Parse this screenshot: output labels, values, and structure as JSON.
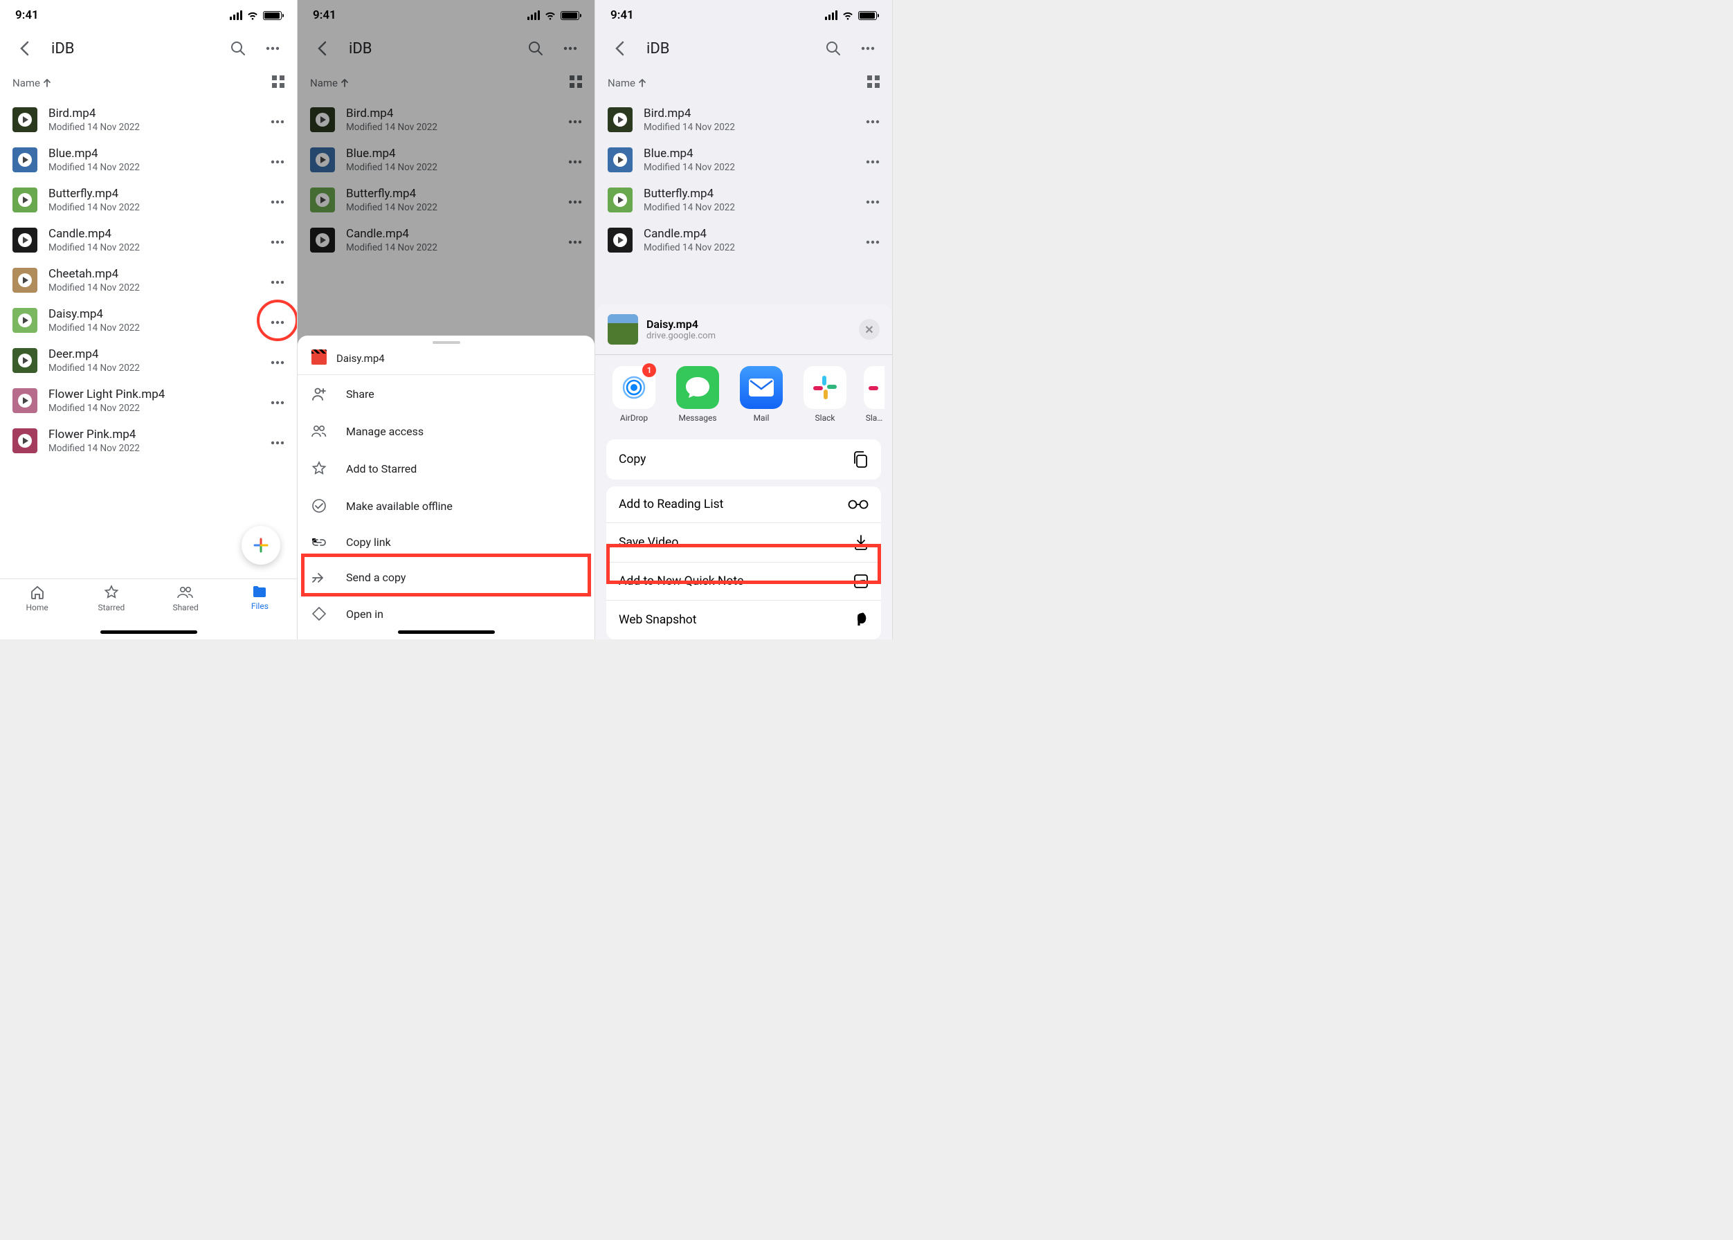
{
  "status": {
    "time": "9:41"
  },
  "header": {
    "title": "iDB"
  },
  "sort": {
    "label": "Name"
  },
  "files": [
    {
      "name": "Bird.mp4",
      "sub": "Modified 14 Nov 2022",
      "bg": "#2b3a1f"
    },
    {
      "name": "Blue.mp4",
      "sub": "Modified 14 Nov 2022",
      "bg": "#3b6ea8"
    },
    {
      "name": "Butterfly.mp4",
      "sub": "Modified 14 Nov 2022",
      "bg": "#6aa84f"
    },
    {
      "name": "Candle.mp4",
      "sub": "Modified 14 Nov 2022",
      "bg": "#1b1b1b"
    },
    {
      "name": "Cheetah.mp4",
      "sub": "Modified 14 Nov 2022",
      "bg": "#b08b5b"
    },
    {
      "name": "Daisy.mp4",
      "sub": "Modified 14 Nov 2022",
      "bg": "#7bb661"
    },
    {
      "name": "Deer.mp4",
      "sub": "Modified 14 Nov 2022",
      "bg": "#3b5d2b"
    },
    {
      "name": "Flower Light Pink.mp4",
      "sub": "Modified 14 Nov 2022",
      "bg": "#b66c8a"
    },
    {
      "name": "Flower Pink.mp4",
      "sub": "Modified 14 Nov 2022",
      "bg": "#a33c5d"
    }
  ],
  "tabs": {
    "home": "Home",
    "starred": "Starred",
    "shared": "Shared",
    "files": "Files"
  },
  "sheet": {
    "file": "Daisy.mp4",
    "share": "Share",
    "manage": "Manage access",
    "star": "Add to Starred",
    "offline": "Make available offline",
    "link": "Copy link",
    "send": "Send a copy",
    "openin": "Open in"
  },
  "p3files": [
    {
      "name": "Bird.mp4",
      "sub": "Modified 14 Nov 2022",
      "bg": "#2b3a1f"
    },
    {
      "name": "Blue.mp4",
      "sub": "Modified 14 Nov 2022",
      "bg": "#3b6ea8"
    },
    {
      "name": "Butterfly.mp4",
      "sub": "Modified 14 Nov 2022",
      "bg": "#6aa84f"
    },
    {
      "name": "Candle.mp4",
      "sub": "Modified 14 Nov 2022",
      "bg": "#1b1b1b"
    }
  ],
  "share": {
    "title": "Daisy.mp4",
    "sub": "drive.google.com",
    "apps": {
      "airdrop": "AirDrop",
      "messages": "Messages",
      "mail": "Mail",
      "slack": "Slack",
      "slack2": "Sla…"
    },
    "badge": "1",
    "copy": "Copy",
    "reading": "Add to Reading List",
    "save": "Save Video",
    "quicknote": "Add to New Quick Note",
    "snapshot": "Web Snapshot"
  }
}
